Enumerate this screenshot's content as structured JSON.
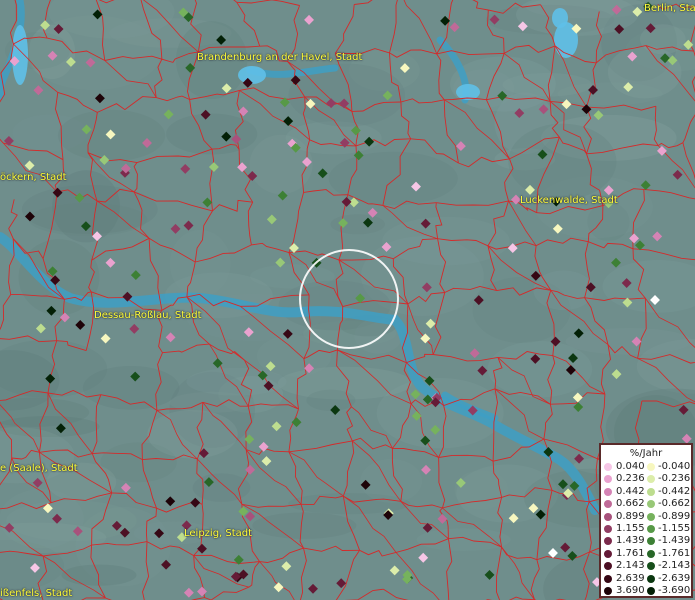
{
  "map": {
    "city_labels": [
      {
        "id": "brandenburg",
        "text": "Brandenburg an der Havel, Stadt"
      },
      {
        "id": "berlin",
        "text": "Berlin, Stadt"
      },
      {
        "id": "goeckern",
        "text": "öckern, Stadt"
      },
      {
        "id": "luckenwalde",
        "text": "Luckenwalde, Stadt"
      },
      {
        "id": "dessau",
        "text": "Dessau-Roßlau, Stadt"
      },
      {
        "id": "halle",
        "text": "e (Saale), Stadt"
      },
      {
        "id": "leipzig",
        "text": "Leipzig, Stadt"
      },
      {
        "id": "weissenfels",
        "text": "ißenfels, Stadt"
      }
    ],
    "colors": {
      "background": "#6f8e8c",
      "water": "#3e9fc4",
      "boundary": "#d42a2a",
      "label": "#ffff3a",
      "focus_ring": "#ffffff"
    }
  },
  "legend": {
    "title": "%/Jahr",
    "positive": [
      {
        "label": "0.040",
        "color": "#f6c6e6"
      },
      {
        "label": "0.236",
        "color": "#eaa2cf"
      },
      {
        "label": "0.442",
        "color": "#d583b5"
      },
      {
        "label": "0.662",
        "color": "#c06a98"
      },
      {
        "label": "0.899",
        "color": "#a8527c"
      },
      {
        "label": "1.155",
        "color": "#923d63"
      },
      {
        "label": "1.439",
        "color": "#7c2a4c"
      },
      {
        "label": "1.761",
        "color": "#651b37"
      },
      {
        "label": "2.143",
        "color": "#4d1024"
      },
      {
        "label": "2.639",
        "color": "#360714"
      },
      {
        "label": "3.690",
        "color": "#1e0308"
      }
    ],
    "negative": [
      {
        "label": "-0.040",
        "color": "#f7f7bf"
      },
      {
        "label": "-0.236",
        "color": "#dcedaa"
      },
      {
        "label": "-0.442",
        "color": "#bddd8f"
      },
      {
        "label": "-0.662",
        "color": "#98c877"
      },
      {
        "label": "-0.899",
        "color": "#76b25d"
      },
      {
        "label": "-1.155",
        "color": "#579947"
      },
      {
        "label": "-1.439",
        "color": "#3d8035"
      },
      {
        "label": "-1.761",
        "color": "#286728"
      },
      {
        "label": "-2.143",
        "color": "#174f1b"
      },
      {
        "label": "-2.639",
        "color": "#0b3710"
      },
      {
        "label": "-3.690",
        "color": "#032006"
      }
    ]
  }
}
